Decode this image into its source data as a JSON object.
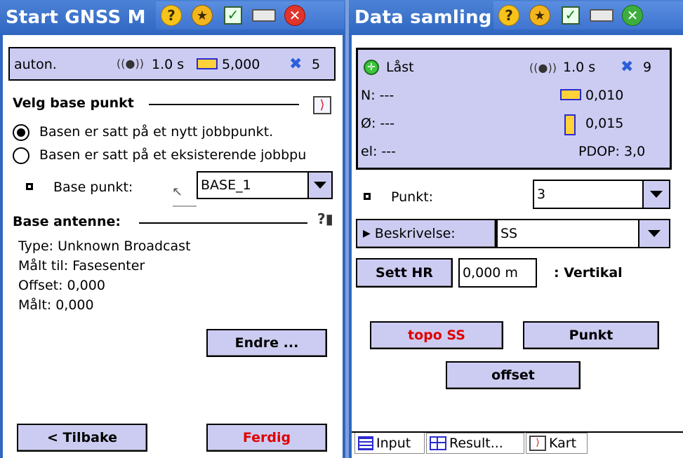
{
  "left": {
    "title": "Start GNSS M",
    "status": {
      "mode": "auton.",
      "interval": "1.0 s",
      "precision": "5,000",
      "satellites": "5"
    },
    "section1_title": "Velg base punkt",
    "radio1": "Basen er satt på et nytt jobbpunkt.",
    "radio2": "Basen er satt på et eksisterende jobbpu",
    "base_label": "Base punkt:",
    "base_value": "BASE_1",
    "section2_title": "Base antenne:",
    "antenna": {
      "type": "Type: Unknown Broadcast",
      "measured_to": "Målt til: Fasesenter",
      "offset": "Offset: 0,000",
      "measured": "Målt: 0,000"
    },
    "edit_button": "Endre ...",
    "back_button": "< Tilbake",
    "finish_button": "Ferdig"
  },
  "right": {
    "title": "Data samling",
    "status": {
      "state": "Låst",
      "interval": "1.0 s",
      "satellites": "9",
      "n": "N: ---",
      "o": "Ø: ---",
      "el": "el: ---",
      "horiz": "0,010",
      "vert": "0,015",
      "pdop": "PDOP: 3,0"
    },
    "punkt_label": "Punkt:",
    "punkt_value": "3",
    "beskrivelse_button": "Beskrivelse:",
    "beskrivelse_value": "SS",
    "hr_button": "Sett HR",
    "hr_value": "0,000 m",
    "hr_mode": ": Vertikal",
    "topo_button": "topo SS",
    "punkt_button": "Punkt",
    "offset_button": "offset",
    "tabs": [
      "Input",
      "Result...",
      "Kart"
    ]
  },
  "icons": [
    "help-icon",
    "favorite-star-icon",
    "checklist-icon",
    "keyboard-icon",
    "close-icon"
  ]
}
